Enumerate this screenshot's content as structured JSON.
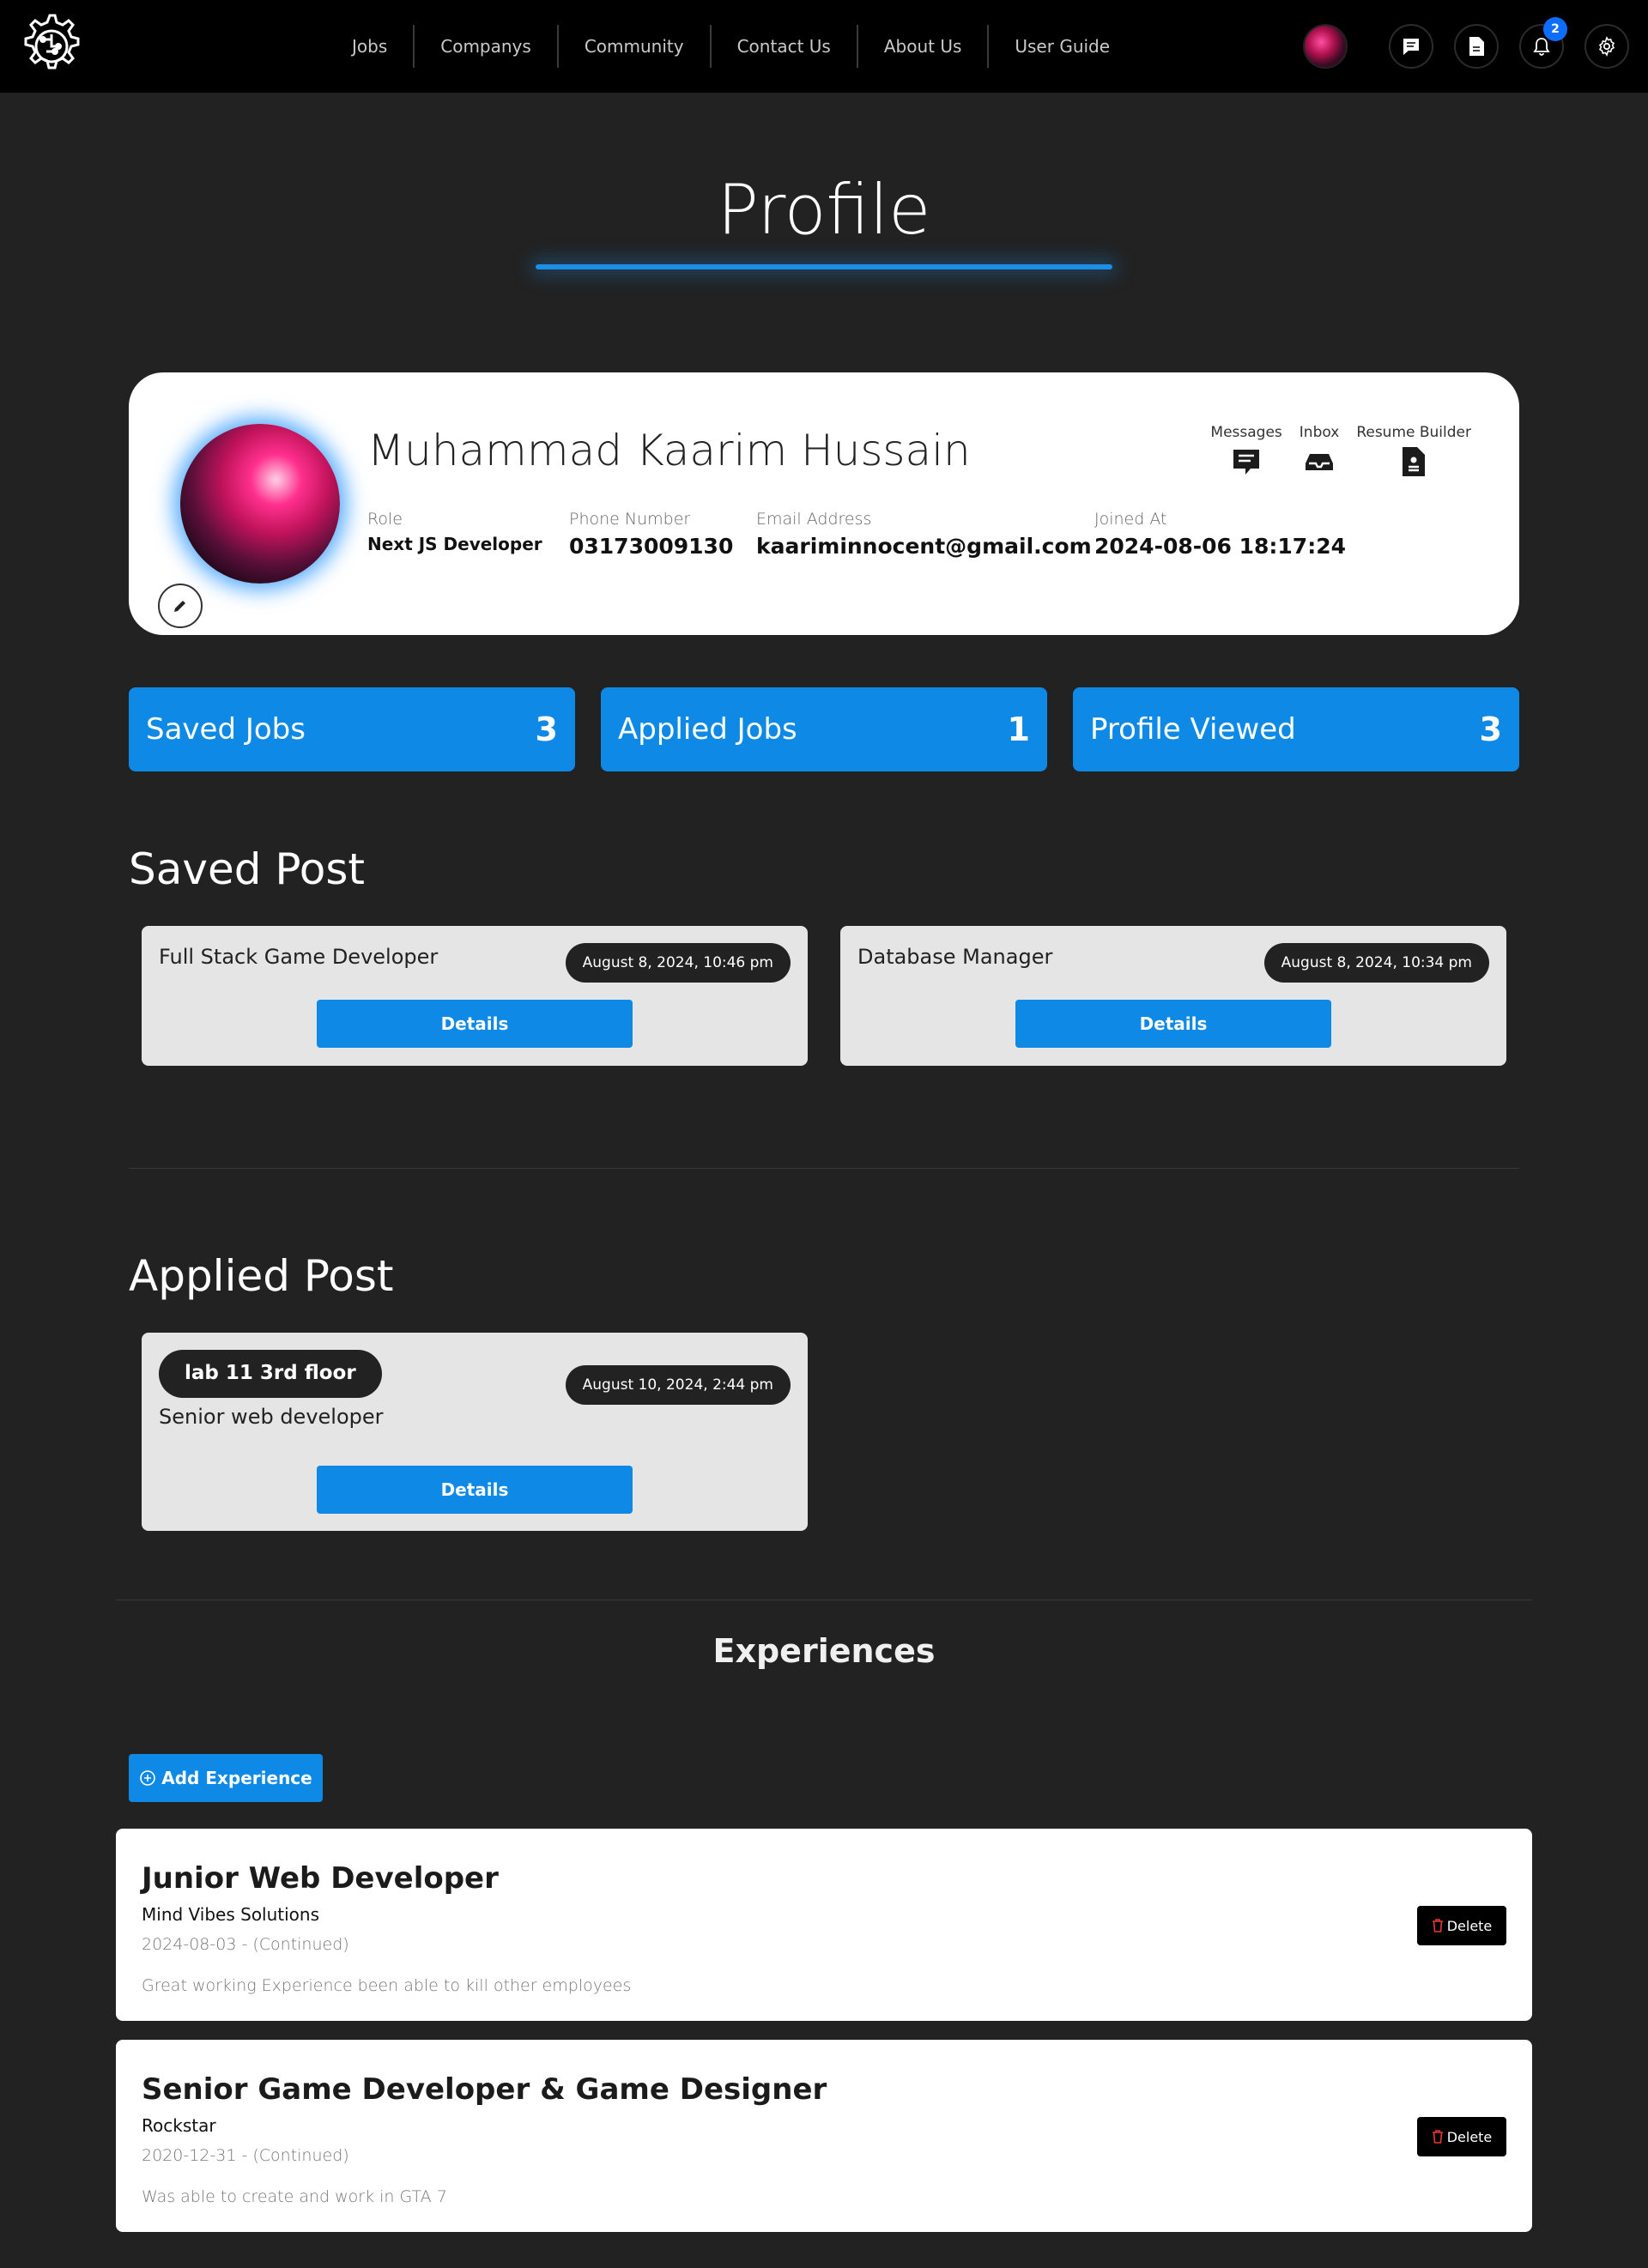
{
  "nav": {
    "links": [
      "Jobs",
      "Companys",
      "Community",
      "Contact Us",
      "About Us",
      "User Guide"
    ],
    "notification_count": "2",
    "icons": [
      "logo-gear-brain-icon",
      "chat-icon",
      "document-icon",
      "bell-icon",
      "gear-icon"
    ]
  },
  "page": {
    "title": "Profile"
  },
  "profile": {
    "name": "Muhammad Kaarim Hussain",
    "role_label": "Role",
    "role": "Next JS Developer",
    "phone_label": "Phone Number",
    "phone": "03173009130",
    "email_label": "Email Address",
    "email": "kaariminnocent@gmail.com",
    "joined_label": "Joined At",
    "joined": "2024-08-06 18:17:24",
    "quick_links": [
      {
        "label": "Messages",
        "icon": "message-icon"
      },
      {
        "label": "Inbox",
        "icon": "inbox-icon"
      },
      {
        "label": "Resume Builder",
        "icon": "resume-icon"
      }
    ]
  },
  "stats": [
    {
      "label": "Saved Jobs",
      "value": "3"
    },
    {
      "label": "Applied Jobs",
      "value": "1"
    },
    {
      "label": "Profile Viewed",
      "value": "3"
    }
  ],
  "saved_posts": {
    "title": "Saved Post",
    "items": [
      {
        "title": "Full Stack Game Developer",
        "date": "August 8, 2024, 10:46 pm",
        "button": "Details"
      },
      {
        "title": "Database Manager",
        "date": "August 8, 2024, 10:34 pm",
        "button": "Details"
      }
    ]
  },
  "applied_posts": {
    "title": "Applied Post",
    "items": [
      {
        "location": "lab 11 3rd floor",
        "title": "Senior web developer",
        "date": "August 10, 2024, 2:44 pm",
        "button": "Details"
      }
    ]
  },
  "experiences": {
    "title": "Experiences",
    "add_label": "Add Experience",
    "delete_label": "Delete",
    "items": [
      {
        "title": "Junior Web Developer",
        "company": "Mind Vibes Solutions",
        "dates": "2024-08-03 - (Continued)",
        "description": "Great working Experience been able to kill other employees"
      },
      {
        "title": "Senior Game Developer & Game Designer",
        "company": "Rockstar",
        "dates": "2020-12-31 - (Continued)",
        "description": "Was able to create and work in GTA 7"
      }
    ]
  },
  "colors": {
    "background": "#222222",
    "navbar": "#000000",
    "accent": "#0f89e6",
    "card": "#ffffff",
    "post_card": "#e5e5e5"
  }
}
